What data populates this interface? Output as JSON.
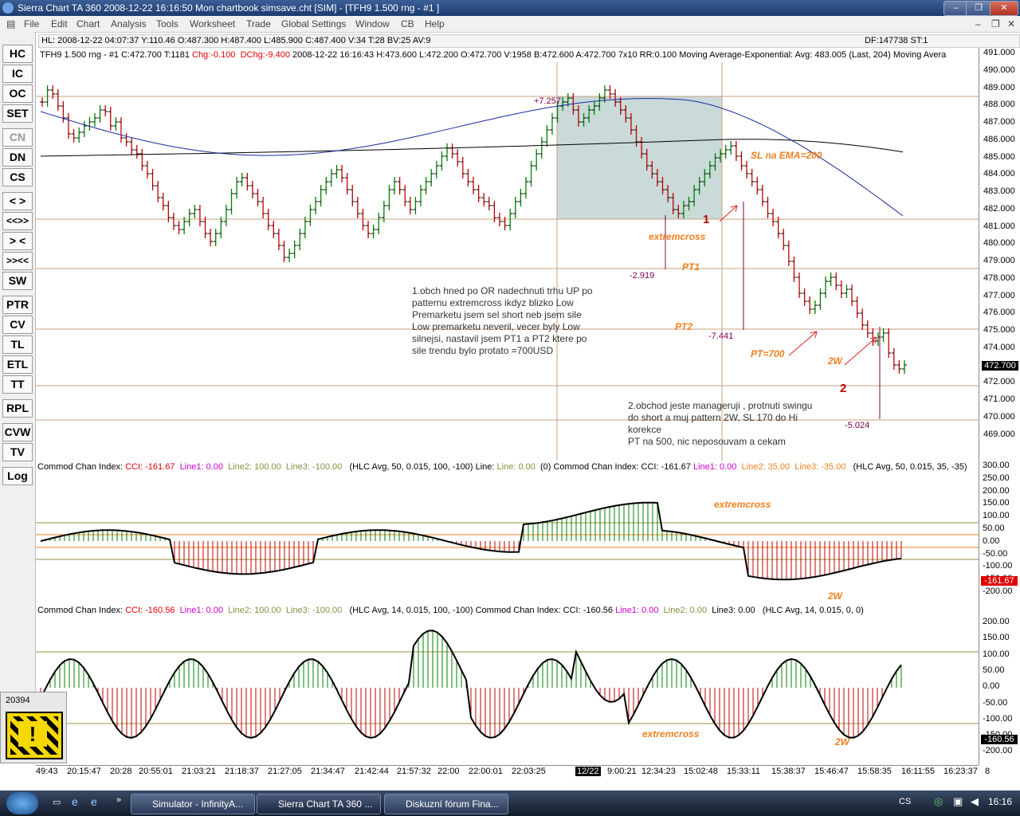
{
  "titlebar": {
    "title": "Sierra Chart TA 360  2008-12-22  16:16:50  Mon   chartbook simsave.cht [SIM] - [TFH9  1.500 rng - #1 ]"
  },
  "menu": [
    "File",
    "Edit",
    "Chart",
    "Analysis",
    "Tools",
    "Worksheet",
    "Trade",
    "Global Settings",
    "Window",
    "CB",
    "Help"
  ],
  "infobar": {
    "left": "HL: 2008-12-22  04:07:37  Y:110.46  O:487.300  H:487.400  L:485.900  C:487.400  V:34  T:28  BV:25  AV:9",
    "right": "DF:147738  ST:1"
  },
  "chart_header": {
    "prefix": "TFH9  1.500 rng - #1  C:472.700  T:1181 ",
    "chg": "Chg:-0.100",
    "dchg": "DChg:-9.400",
    "rest": " 2008-12-22  16:16:43  H:473.600  L:472.200  O:472.700  V:1958  B:472.600  A:472.700  7x10  RR:0.100  Moving Average-Exponential:  Avg: 483.005   (Last, 204)   Moving Avera"
  },
  "sidebar_buttons": [
    "HC",
    "IC",
    "OC",
    "SET",
    "CN",
    "DN",
    "CS",
    "< >",
    "<<>>",
    "> <",
    ">><<",
    "SW",
    "PTR",
    "CV",
    "TL",
    "ETL",
    "TT",
    "RPL",
    "CVW",
    "TV",
    "Log"
  ],
  "price_axis": [
    "491.000",
    "490.000",
    "489.000",
    "488.000",
    "487.000",
    "486.000",
    "485.000",
    "484.000",
    "483.000",
    "482.000",
    "481.000",
    "480.000",
    "479.000",
    "478.000",
    "477.000",
    "476.000",
    "475.000",
    "474.000",
    "473.000",
    "472.000",
    "471.000",
    "470.000",
    "469.000"
  ],
  "last_price": "472.700",
  "cci1_axis": [
    "300.00",
    "250.00",
    "200.00",
    "150.00",
    "100.00",
    "50.00",
    "0.00",
    "-50.00",
    "-100.00",
    "-150.00",
    "-200.00"
  ],
  "cci1_last": "-161.67",
  "cci2_axis": [
    "200.00",
    "150.00",
    "100.00",
    "50.00",
    "0.00",
    "-50.00",
    "-100.00",
    "-150.00",
    "-200.00"
  ],
  "cci2_last": "-160.56",
  "cci1_header": {
    "a": "Commod Chan Index:  ",
    "cci": "CCI: -161.67",
    "l1": "Line1: 0.00",
    "l2": "Line2: 100.00",
    "l3": "Line3: -100.00",
    "b": "(HLC Avg, 50, 0.015, 100, -100)   Line:  ",
    "line": "Line: 0.00",
    "c": "(0)   Commod Chan Index:  CCI: -161.67  ",
    "l1b": "Line1: 0.00",
    "l2b": "Line2: 35.00",
    "l3b": "Line3: -35.00",
    "d": "(HLC Avg, 50, 0.015, 35, -35)"
  },
  "cci2_header": {
    "a": "Commod Chan Index:  ",
    "cci": "CCI: -160.56",
    "l1": "Line1: 0.00",
    "l2": "Line2: 100.00",
    "l3": "Line3: -100.00",
    "b": "(HLC Avg, 14, 0.015, 100, -100)   Commod Chan Index:  CCI: -160.56  ",
    "l1b": "Line1: 0.00",
    "l2b": "Line2: 0.00",
    "l3b": "Line3: 0.00",
    "d": "(HLC Avg, 14, 0.015, 0, 0)"
  },
  "time_axis": [
    "49:43",
    "20:15:47",
    "20:28",
    "20:55:01",
    "21:03:21",
    "21:18:37",
    "21:27:05",
    "21:34:47",
    "21:42:44",
    "21:57:32",
    "22:00",
    "22:00:01",
    "22:03:25",
    "12/22",
    "9:00:21",
    "12:34:23",
    "15:02:48",
    "15:33:11",
    "15:38:37",
    "15:46:47",
    "15:58:35",
    "16:11:55",
    "16:23:37",
    "8"
  ],
  "annotations": {
    "box_top": "+7.257",
    "box_bottom": "-2.919",
    "pt2_val": "-7.441",
    "last_val": "-5.024",
    "sl": "SL na EMA=200",
    "extremcross": "extremcross",
    "pt1": "PT1",
    "pt2": "PT2",
    "pt700": "PT=700",
    "two_w": "2W",
    "num1": "1",
    "num2": "2",
    "note1": "1.obch hned po OR nadechnuti trhu UP po\npatternu extremcross ikdyz blizko Low\nPremarketu jsem sel short neb jsem sile\nLow premarketu neveril, vecer byly Low\nsilnejsi, nastavil jsem PT1 a PT2 ktere po\nsile trendu bylo protato =700USD",
    "note2": "2.obchod jeste manageruji , protnuti swingu\ndo short a muj pattern 2W, SL 170 do Hi\nkorekce\nPT na 500, nic neposouvam a cekam"
  },
  "alert": {
    "number": "20394"
  },
  "taskbar": {
    "tasks": [
      "Simulator - InfinityA...",
      "Sierra Chart TA 360 ...",
      "Diskuzní fórum Fina..."
    ],
    "lang": "CS",
    "clock": "16:16"
  },
  "colors": {
    "up_bar": "#008000",
    "down_bar": "#c00000",
    "ema_fast": "#1a2a9a",
    "ema_slow": "#000000",
    "annot": "#f08020",
    "box": "#c9dad9"
  }
}
